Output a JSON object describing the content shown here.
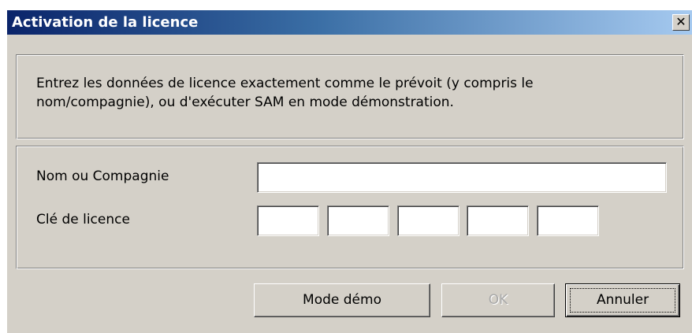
{
  "window": {
    "title": "Activation de la licence",
    "close_glyph": "✕"
  },
  "info": {
    "line1": "Entrez les données de licence exactement comme le prévoit (y compris le",
    "line2": "nom/compagnie), ou d'exécuter SAM en mode démonstration."
  },
  "form": {
    "name_label": "Nom ou Compagnie",
    "name_value": "",
    "key_label": "Clé de licence",
    "key_segments": [
      "",
      "",
      "",
      "",
      ""
    ]
  },
  "buttons": {
    "demo_label": "Mode démo",
    "ok_label": "OK",
    "cancel_label": "Annuler"
  },
  "colors": {
    "title_gradient_start": "#0a246a",
    "title_gradient_end": "#a6caf0",
    "dialog_face": "#d4d0c8",
    "disabled_text": "#a8a8a8"
  }
}
